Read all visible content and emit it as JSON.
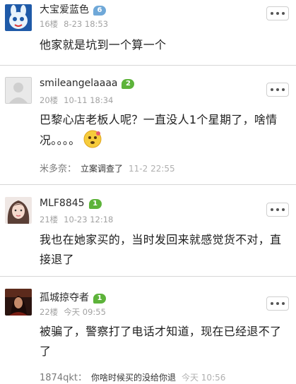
{
  "posts": [
    {
      "username": "大宝爱蓝色",
      "level": "6",
      "level_color": "#6fa8d8",
      "floor": "16楼",
      "time": "8-23 18:53",
      "content": "他家就是坑到一个算一个"
    },
    {
      "username": "smileangelaaaa",
      "level": "2",
      "level_color": "#5db33a",
      "floor": "20楼",
      "time": "10-11 18:34",
      "content": "巴黎心店老板人呢？一直没人1个星期了，啥情况。。。。",
      "reply": {
        "name": "米多奈：",
        "text": "立案调查了",
        "time": "11-2 22:55"
      }
    },
    {
      "username": "MLF8845",
      "level": "1",
      "level_color": "#5db33a",
      "floor": "21楼",
      "time": "10-23 12:18",
      "content": "我也在她家买的，当时发回来就感觉货不对，直接退了"
    },
    {
      "username": "孤城掠夺者",
      "level": "1",
      "level_color": "#5db33a",
      "floor": "22楼",
      "time": "今天 09:55",
      "content": "被骗了，警察打了电话才知道，现在已经退不了了",
      "reply": {
        "name": "1874qkt：",
        "text": "你啥时候买的没给你退",
        "time": "今天 10:56"
      }
    }
  ],
  "icons": {
    "more": "more-dots-icon",
    "emoji": "confused-face-emoji"
  }
}
